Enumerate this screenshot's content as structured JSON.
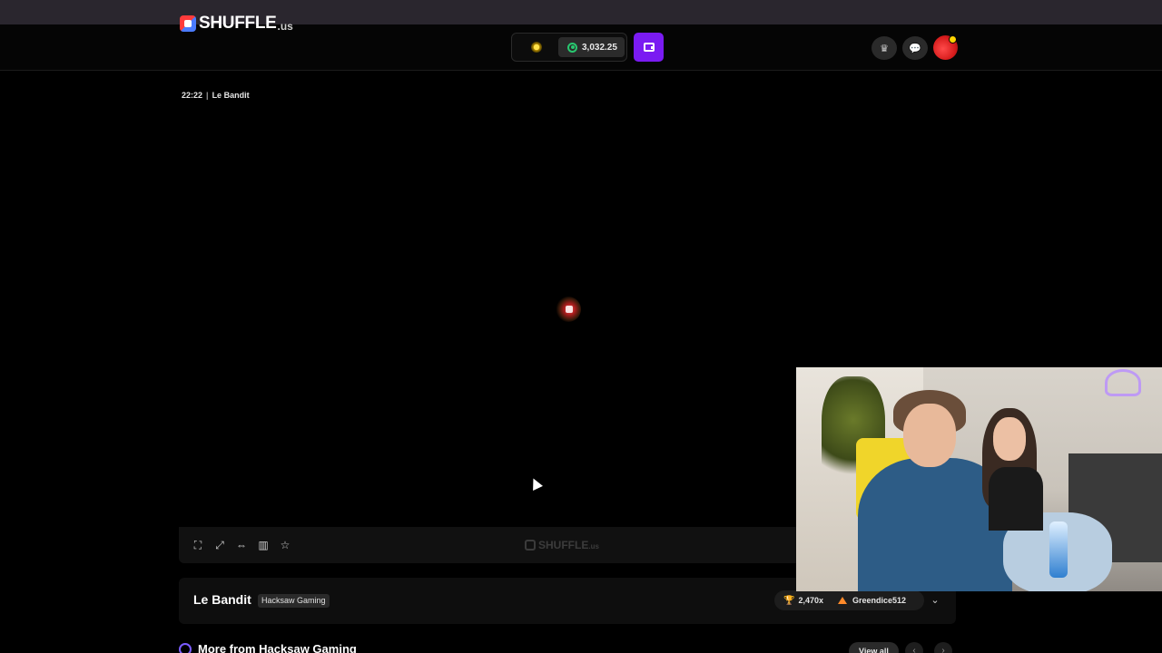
{
  "header": {
    "logo_text": "SHUFFLE",
    "logo_suffix": ".us",
    "balance": "3,032.25",
    "wallet_button_icon": "wallet-icon",
    "icons": [
      "crown-icon",
      "chat-icon"
    ],
    "avatar_badge": "notification-dot"
  },
  "game": {
    "timestamp": "22:22",
    "separator": "|",
    "breadcrumb_name": "Le Bandit",
    "toolbar_icons": [
      "theater-mode-icon",
      "fullscreen-icon",
      "width-icon",
      "stats-icon",
      "star-icon"
    ],
    "watermark_text": "SHUFFLE",
    "watermark_suffix": ".us"
  },
  "info": {
    "title": "Le Bandit",
    "provider": "Hacksaw Gaming",
    "record_multiplier": "2,470x",
    "record_player": "Greendice512"
  },
  "more": {
    "title": "More from Hacksaw Gaming",
    "view_all": "View all"
  },
  "colors": {
    "accent": "#7a1bf2",
    "balance_green": "#28c76f",
    "trophy_gold": "#ffc72c"
  }
}
